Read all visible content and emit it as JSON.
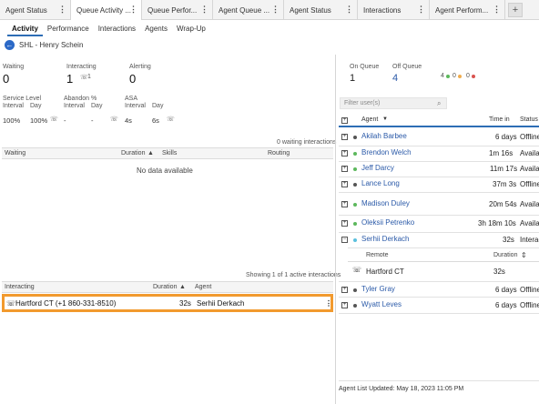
{
  "top_tabs": [
    {
      "label": "Agent Status",
      "active": false
    },
    {
      "label": "Queue Activity ...",
      "active": true
    },
    {
      "label": "Queue Perfor...",
      "active": false
    },
    {
      "label": "Agent Queue ...",
      "active": false
    },
    {
      "label": "Agent Status",
      "active": false
    },
    {
      "label": "Interactions",
      "active": false
    },
    {
      "label": "Agent Perform...",
      "active": false
    }
  ],
  "add_tab": "+",
  "sub_tabs": [
    "Activity",
    "Performance",
    "Interactions",
    "Agents",
    "Wrap-Up"
  ],
  "breadcrumb": "SHL - Henry Schein",
  "summary": {
    "waiting_label": "Waiting",
    "waiting_value": "0",
    "interacting_label": "Interacting",
    "interacting_value": "1",
    "interacting_calls": "1",
    "alerting_label": "Alerting",
    "alerting_value": "0"
  },
  "metrics": {
    "service_level": "Service Level",
    "abandon": "Abandon %",
    "asa": "ASA",
    "interval": "Interval",
    "day": "Day",
    "sl_interval": "100%",
    "sl_day": "100%",
    "ab_interval": "-",
    "ab_day": "-",
    "asa_interval": "4s",
    "asa_day": "6s"
  },
  "waiting_table": {
    "count_text": "0 waiting interactions",
    "headers": [
      "Waiting",
      "Duration",
      "Skills",
      "Routing"
    ],
    "empty": "No data available"
  },
  "interacting_table": {
    "count_text": "Showing 1 of 1 active interactions",
    "headers": [
      "Interacting",
      "Duration",
      "Agent"
    ],
    "row": {
      "name": "Hartford CT (+1 860-331-8510)",
      "duration": "32s",
      "agent": "Serhii Derkach"
    }
  },
  "right": {
    "on_queue_label": "On Queue",
    "on_queue_value": "1",
    "off_queue_label": "Off Queue",
    "off_queue_value": "4",
    "status_counts": [
      "4",
      "0",
      "0"
    ],
    "filter_placeholder": "Filter user(s)",
    "headers": {
      "agent": "Agent",
      "time_in": "Time in",
      "status": "Status"
    },
    "agents": [
      {
        "name": "Akilah Barbee",
        "time": "6 days",
        "status": "Offline",
        "dot": "#555555"
      },
      {
        "name": "Brendon Welch",
        "time": "1m 16s",
        "status": "Available",
        "dot": "#5cb85c"
      },
      {
        "name": "Jeff Darcy",
        "time": "11m 17s",
        "status": "Available",
        "dot": "#5cb85c"
      },
      {
        "name": "Lance Long",
        "time": "37m 3s",
        "status": "Offline",
        "dot": "#555555"
      },
      {
        "name": "Madison Duley",
        "time": "20m 54s",
        "status": "Available",
        "dot": "#5cb85c"
      },
      {
        "name": "Oleksii Petrenko",
        "time": "3h 18m 10s",
        "status": "Available",
        "dot": "#5cb85c"
      },
      {
        "name": "Serhii Derkach",
        "time": "32s",
        "status": "Interacting",
        "dot": "#5bc0de"
      },
      {
        "name": "Tyler Gray",
        "time": "6 days",
        "status": "Offline",
        "dot": "#555555"
      },
      {
        "name": "Wyatt Leves",
        "time": "6 days",
        "status": "Offline",
        "dot": "#555555"
      }
    ],
    "remote_header": "Remote",
    "duration_header": "Duration",
    "remote_row": {
      "name": "Hartford CT",
      "duration": "32s"
    },
    "updated": "Agent List Updated: May 18, 2023 11:05 PM"
  }
}
